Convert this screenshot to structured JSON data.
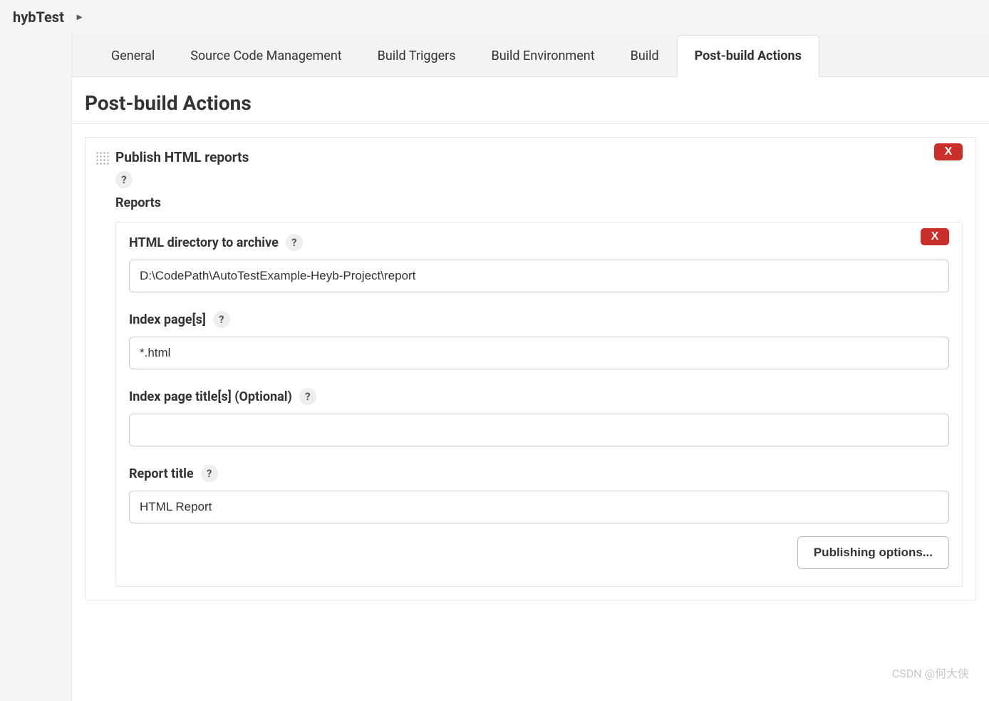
{
  "breadcrumb": {
    "item": "hybTest"
  },
  "tabs": [
    {
      "label": "General",
      "active": false
    },
    {
      "label": "Source Code Management",
      "active": false
    },
    {
      "label": "Build Triggers",
      "active": false
    },
    {
      "label": "Build Environment",
      "active": false
    },
    {
      "label": "Build",
      "active": false
    },
    {
      "label": "Post-build Actions",
      "active": true
    }
  ],
  "section": {
    "title": "Post-build Actions"
  },
  "block": {
    "title": "Publish HTML reports",
    "help": "?",
    "subheading": "Reports",
    "delete": "X"
  },
  "report": {
    "delete": "X",
    "fields": {
      "html_dir": {
        "label": "HTML directory to archive",
        "help": "?",
        "value": "D:\\CodePath\\AutoTestExample-Heyb-Project\\report"
      },
      "index_pages": {
        "label": "Index page[s]",
        "help": "?",
        "value": "*.html"
      },
      "index_titles": {
        "label": "Index page title[s] (Optional)",
        "help": "?",
        "value": ""
      },
      "report_title": {
        "label": "Report title",
        "help": "?",
        "value": "HTML Report"
      }
    },
    "publishing_options": "Publishing options..."
  },
  "watermark": "CSDN @何大侠"
}
